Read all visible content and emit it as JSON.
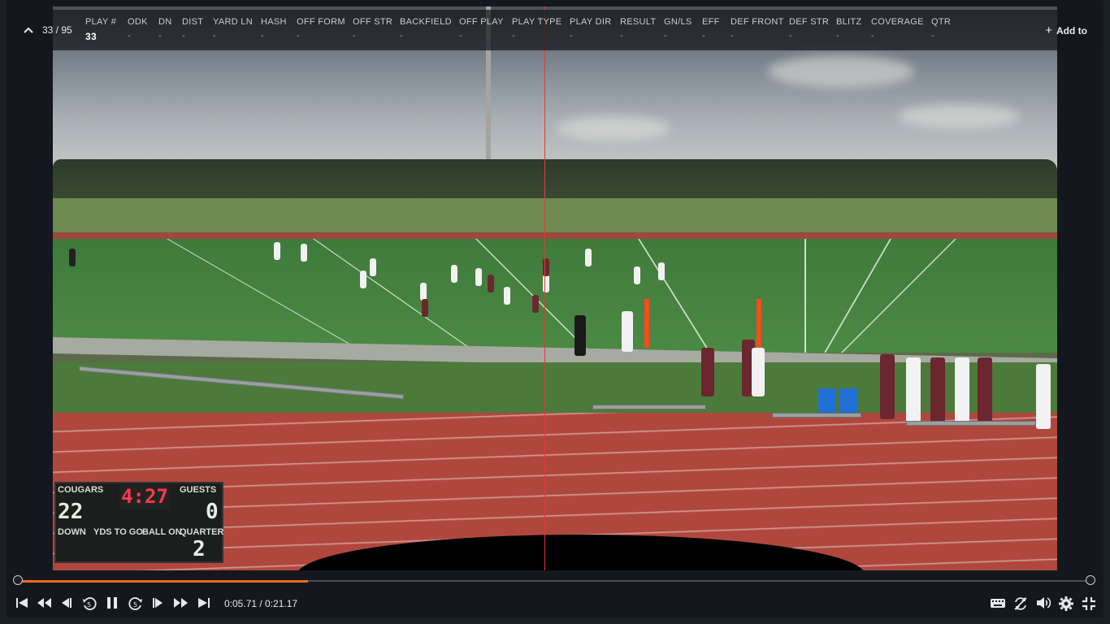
{
  "header": {
    "counter": "33 / 95",
    "add_to_label": "Add to",
    "fields": [
      {
        "label": "PLAY #",
        "value": "33"
      },
      {
        "label": "ODK",
        "value": "-"
      },
      {
        "label": "DN",
        "value": "-"
      },
      {
        "label": "DIST",
        "value": "-"
      },
      {
        "label": "YARD LN",
        "value": "-"
      },
      {
        "label": "HASH",
        "value": "-"
      },
      {
        "label": "OFF FORM",
        "value": "-"
      },
      {
        "label": "OFF STR",
        "value": "-"
      },
      {
        "label": "BACKFIELD",
        "value": "-"
      },
      {
        "label": "OFF PLAY",
        "value": "-"
      },
      {
        "label": "PLAY TYPE",
        "value": "-"
      },
      {
        "label": "PLAY DIR",
        "value": "-"
      },
      {
        "label": "RESULT",
        "value": "-"
      },
      {
        "label": "GN/LS",
        "value": "-"
      },
      {
        "label": "EFF",
        "value": "-"
      },
      {
        "label": "DEF FRONT",
        "value": "-"
      },
      {
        "label": "DEF STR",
        "value": "-"
      },
      {
        "label": "BLITZ",
        "value": "-"
      },
      {
        "label": "COVERAGE",
        "value": "-"
      },
      {
        "label": "QTR",
        "value": "-"
      }
    ]
  },
  "scoreboard": {
    "home_label": "COUGARS",
    "guest_label": "GUESTS",
    "home_score": "22",
    "guest_score": "0",
    "clock": "4:27",
    "down_label": "DOWN",
    "yds_label": "YDS TO GO",
    "ball_label": "BALL ON",
    "quarter_label": "QUARTER",
    "quarter": "2"
  },
  "player": {
    "time_display": "0:05.71 / 0:21.17",
    "progress": 0.27
  },
  "colors": {
    "accent": "#f26a1b",
    "playhead": "#e23a3a"
  }
}
